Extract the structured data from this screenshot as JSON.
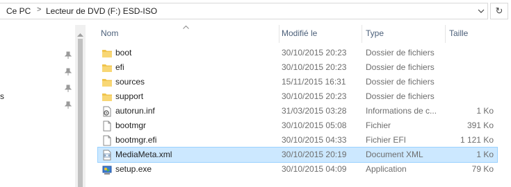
{
  "breadcrumb": {
    "items": [
      "Ce PC",
      "Lecteur de DVD (F:) ESD-ISO"
    ],
    "separator": ">"
  },
  "navpane": {
    "partial_text": "s"
  },
  "columns": {
    "name": "Nom",
    "modified": "Modifié le",
    "type": "Type",
    "size": "Taille"
  },
  "files": [
    {
      "name": "boot",
      "modified": "30/10/2015 20:23",
      "type": "Dossier de fichiers",
      "size": "",
      "icon": "folder-icon"
    },
    {
      "name": "efi",
      "modified": "30/10/2015 20:23",
      "type": "Dossier de fichiers",
      "size": "",
      "icon": "folder-icon"
    },
    {
      "name": "sources",
      "modified": "15/11/2015 16:31",
      "type": "Dossier de fichiers",
      "size": "",
      "icon": "folder-icon"
    },
    {
      "name": "support",
      "modified": "30/10/2015 20:23",
      "type": "Dossier de fichiers",
      "size": "",
      "icon": "folder-icon"
    },
    {
      "name": "autorun.inf",
      "modified": "31/03/2015 03:28",
      "type": "Informations de c...",
      "size": "1 Ko",
      "icon": "settings-file-icon"
    },
    {
      "name": "bootmgr",
      "modified": "30/10/2015 05:08",
      "type": "Fichier",
      "size": "391 Ko",
      "icon": "file-icon"
    },
    {
      "name": "bootmgr.efi",
      "modified": "30/10/2015 04:33",
      "type": "Fichier EFI",
      "size": "1 121 Ko",
      "icon": "file-icon"
    },
    {
      "name": "MediaMeta.xml",
      "modified": "30/10/2015 20:19",
      "type": "Document XML",
      "size": "1 Ko",
      "icon": "xml-file-icon",
      "selected": true
    },
    {
      "name": "setup.exe",
      "modified": "30/10/2015 04:09",
      "type": "Application",
      "size": "79 Ko",
      "icon": "setup-app-icon"
    }
  ],
  "colors": {
    "selection": "#cce8ff",
    "selection_border": "#99d1ff",
    "header_text": "#4c607a",
    "folder": "#f0c44c"
  }
}
